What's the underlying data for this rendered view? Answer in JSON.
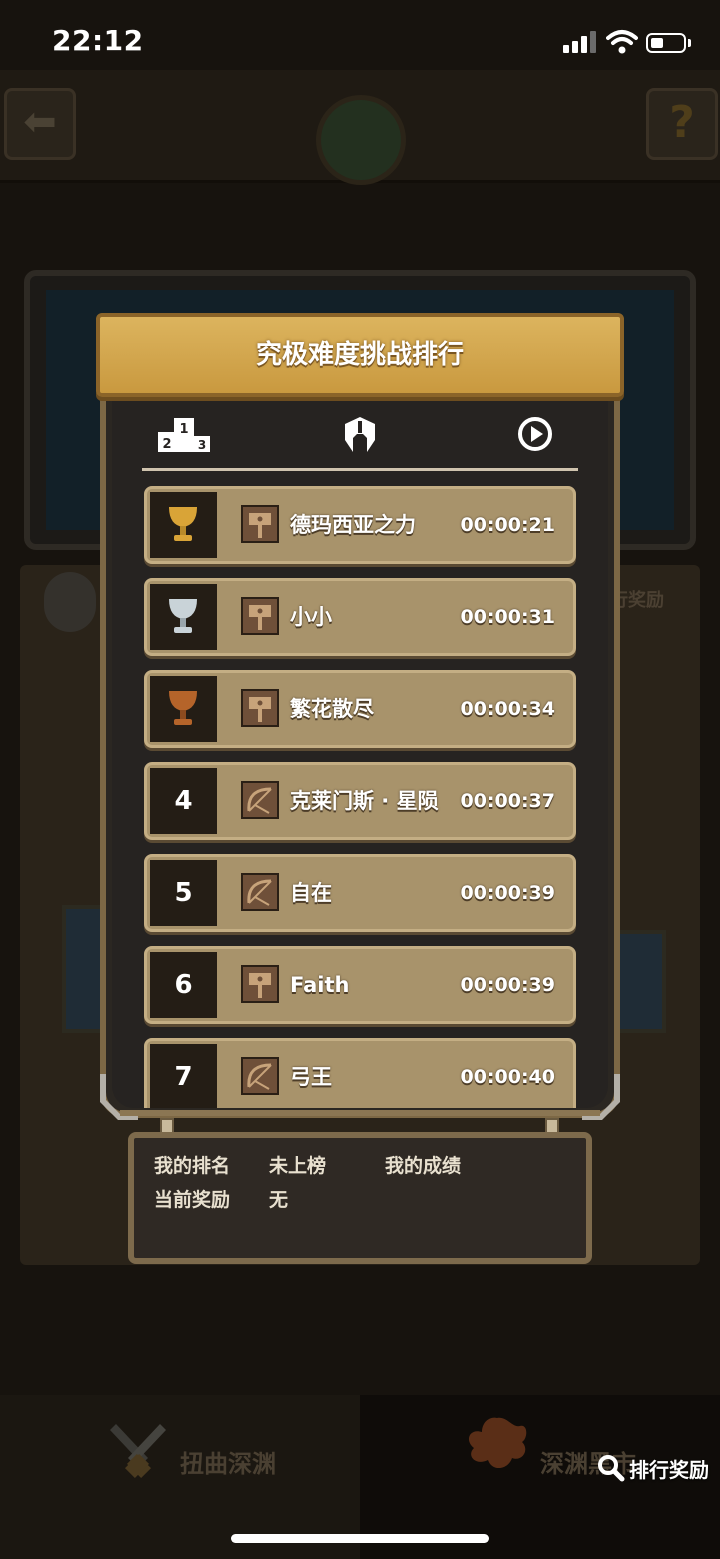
{
  "status_bar": {
    "time": "22:12"
  },
  "modal": {
    "title": "究极难度挑战排行",
    "headers": [
      {
        "icon": "podium-icon",
        "podium_digits": [
          "1",
          "2",
          "3"
        ]
      },
      {
        "icon": "helmet-icon"
      },
      {
        "icon": "play-clock-icon"
      }
    ],
    "rankings": [
      {
        "rank": "1",
        "medal": "gold-cup-icon",
        "class": "hammer",
        "name": "德玛西亚之力",
        "time": "00:00:21"
      },
      {
        "rank": "2",
        "medal": "silver-cup-icon",
        "class": "hammer",
        "name": "小小",
        "time": "00:00:31"
      },
      {
        "rank": "3",
        "medal": "bronze-cup-icon",
        "class": "hammer",
        "name": "繁花散尽",
        "time": "00:00:34"
      },
      {
        "rank": "4",
        "medal": "",
        "class": "bow",
        "name": "克莱门斯 · 星陨",
        "time": "00:00:37"
      },
      {
        "rank": "5",
        "medal": "",
        "class": "bow",
        "name": "自在",
        "time": "00:00:39"
      },
      {
        "rank": "6",
        "medal": "",
        "class": "hammer",
        "name": "Faith",
        "time": "00:00:39"
      },
      {
        "rank": "7",
        "medal": "",
        "class": "bow",
        "name": "弓王",
        "time": "00:00:40"
      }
    ],
    "my_stats": {
      "rank_label": "我的排名",
      "rank_value": "未上榜",
      "score_label": "我的成绩",
      "score_value": "",
      "reward_label": "当前奖励",
      "reward_value": "无"
    }
  },
  "background": {
    "side_label": "行奖励",
    "tabs": [
      {
        "label": "扭曲深渊",
        "icon": "crossed-swords-icon"
      },
      {
        "label": "深渊黑市",
        "icon": "splat-icon"
      }
    ]
  },
  "overlay": {
    "search_reward_label": "排行奖励"
  },
  "colors": {
    "gold": "#d4a94f",
    "cup_gold": "#d9a437",
    "cup_silver": "#c9d3d8",
    "cup_bronze": "#b5642a",
    "row": "#a8936b"
  }
}
